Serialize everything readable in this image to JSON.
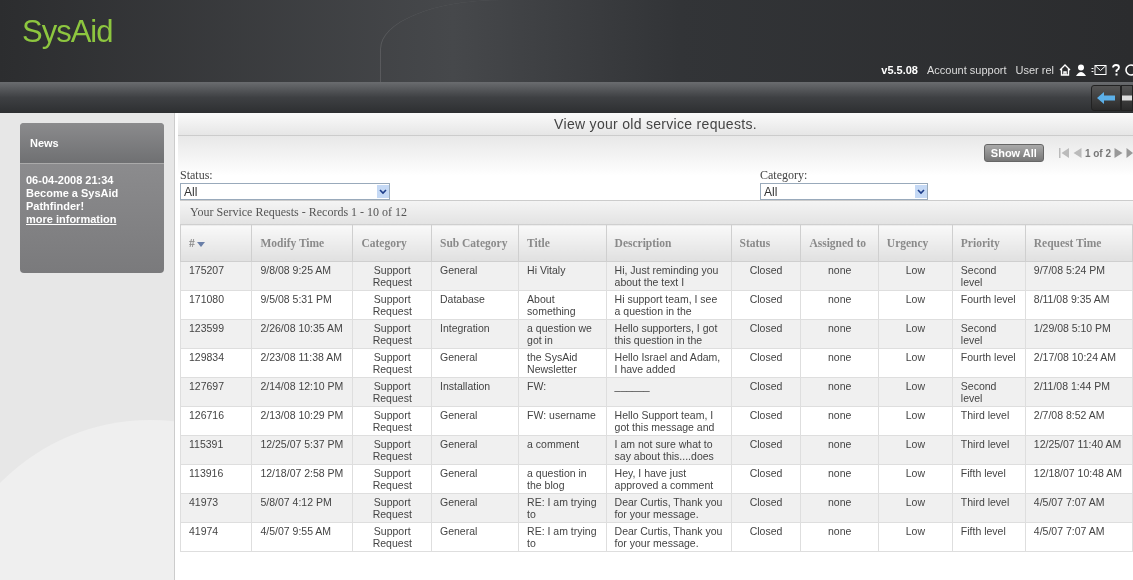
{
  "header": {
    "logo": "SysAid",
    "version": "v5.5.08",
    "account": "Account support",
    "user": "User rel"
  },
  "news": {
    "title": "News",
    "date": "06-04-2008 21:34",
    "headline": "Become a SysAid Pathfinder!",
    "link": "more information"
  },
  "page_title": "View your old service requests.",
  "show_all": "Show All",
  "pagination": "1 of 2",
  "filters": [
    {
      "label": "Status:",
      "value": "All"
    },
    {
      "label": "Category:",
      "value": "All"
    }
  ],
  "table": {
    "caption": "Your Service Requests - Records 1 - 10 of 12",
    "columns": [
      {
        "label": "#",
        "sorted": true
      },
      {
        "label": "Modify Time",
        "sorted": false
      },
      {
        "label": "Category",
        "sorted": false
      },
      {
        "label": "Sub Category",
        "sorted": false
      },
      {
        "label": "Title",
        "sorted": false
      },
      {
        "label": "Description",
        "sorted": false
      },
      {
        "label": "Status",
        "sorted": false
      },
      {
        "label": "Assigned to",
        "sorted": false
      },
      {
        "label": "Urgency",
        "sorted": false
      },
      {
        "label": "Priority",
        "sorted": false
      },
      {
        "label": "Request Time",
        "sorted": false
      }
    ],
    "rows": [
      [
        "175207",
        "9/8/08 9:25 AM",
        "Support Request",
        "General",
        "Hi Vitaly",
        "Hi, Just reminding you about the text I",
        "Closed",
        "none",
        "Low",
        "Second level",
        "9/7/08 5:24 PM"
      ],
      [
        "171080",
        "9/5/08 5:31 PM",
        "Support Request",
        "Database",
        "About something",
        "Hi support team, I see a question in the",
        "Closed",
        "none",
        "Low",
        "Fourth level",
        "8/11/08 9:35 AM"
      ],
      [
        "123599",
        "2/26/08 10:35 AM",
        "Support Request",
        "Integration",
        "a question we got in",
        "Hello supporters, I got this question in the",
        "Closed",
        "none",
        "Low",
        "Second level",
        "1/29/08 5:10 PM"
      ],
      [
        "129834",
        "2/23/08 11:38 AM",
        "Support Request",
        "General",
        "the SysAid Newsletter",
        "Hello Israel and Adam, I have added",
        "Closed",
        "none",
        "Low",
        "Fourth level",
        "2/17/08 10:24 AM"
      ],
      [
        "127697",
        "2/14/08 12:10 PM",
        "Support Request",
        "Installation",
        "FW:",
        "______",
        "Closed",
        "none",
        "Low",
        "Second level",
        "2/11/08 1:44 PM"
      ],
      [
        "126716",
        "2/13/08 10:29 PM",
        "Support Request",
        "General",
        "FW: username",
        "Hello Support team, I got this message and",
        "Closed",
        "none",
        "Low",
        "Third level",
        "2/7/08 8:52 AM"
      ],
      [
        "115391",
        "12/25/07 5:37 PM",
        "Support Request",
        "General",
        "a comment",
        "I am not sure what to say about this....does",
        "Closed",
        "none",
        "Low",
        "Third level",
        "12/25/07 11:40 AM"
      ],
      [
        "113916",
        "12/18/07 2:58 PM",
        "Support Request",
        "General",
        "a question in the blog",
        "Hey, I have just approved a comment",
        "Closed",
        "none",
        "Low",
        "Fifth level",
        "12/18/07 10:48 AM"
      ],
      [
        "41973",
        "5/8/07 4:12 PM",
        "Support Request",
        "General",
        "RE: I am trying to",
        "Dear Curtis, Thank you for your message.",
        "Closed",
        "none",
        "Low",
        "Third level",
        "4/5/07 7:07 AM"
      ],
      [
        "41974",
        "4/5/07 9:55 AM",
        "Support Request",
        "General",
        "RE: I am trying to",
        "Dear Curtis, Thank you for your message.",
        "Closed",
        "none",
        "Low",
        "Fifth level",
        "4/5/07 7:07 AM"
      ]
    ]
  }
}
